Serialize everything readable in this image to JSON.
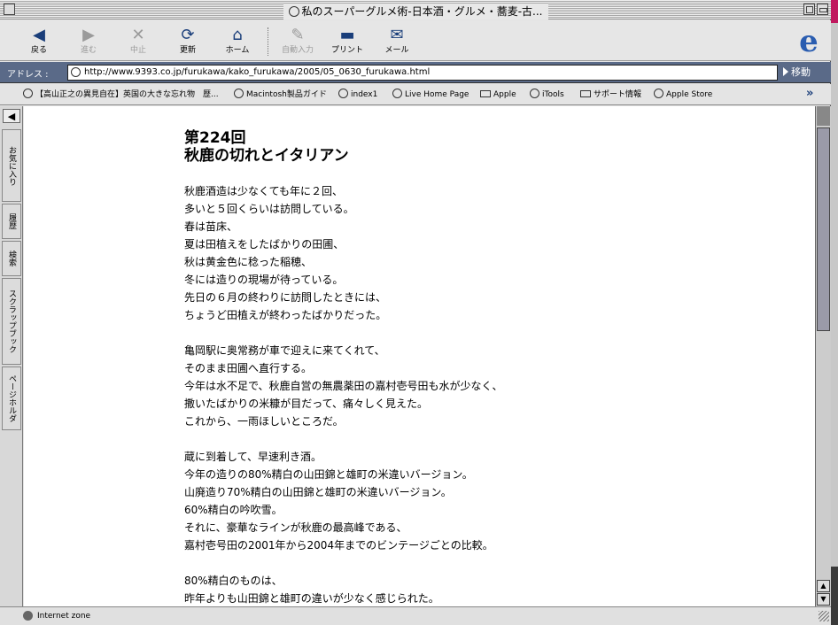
{
  "window": {
    "title": "私のスーパーグルメ術-日本酒・グルメ・蕎麦-古..."
  },
  "toolbar": {
    "buttons": [
      {
        "label": "戻る",
        "icon": "back-arrow-icon",
        "enabled": true
      },
      {
        "label": "進む",
        "icon": "forward-arrow-icon",
        "enabled": false
      },
      {
        "label": "中止",
        "icon": "stop-x-icon",
        "enabled": false
      },
      {
        "label": "更新",
        "icon": "refresh-icon",
        "enabled": true
      },
      {
        "label": "ホーム",
        "icon": "home-icon",
        "enabled": true
      },
      {
        "label": "自動入力",
        "icon": "autofill-icon",
        "enabled": false
      },
      {
        "label": "プリント",
        "icon": "printer-icon",
        "enabled": true
      },
      {
        "label": "メール",
        "icon": "mail-icon",
        "enabled": true
      }
    ]
  },
  "address": {
    "label": "アドレス :",
    "url": "http://www.9393.co.jp/furukawa/kako_furukawa/2005/05_0630_furukawa.html",
    "go_label": "移動"
  },
  "favorites": [
    {
      "label": "【高山正之の異見自在】英国の大きな忘れ物　歴...",
      "icon": "page-globe-icon"
    },
    {
      "label": "Macintosh製品ガイド",
      "icon": "page-globe-icon"
    },
    {
      "label": "index1",
      "icon": "page-globe-icon"
    },
    {
      "label": "Live Home Page",
      "icon": "page-globe-icon"
    },
    {
      "label": "Apple",
      "icon": "folder-icon"
    },
    {
      "label": "iTools",
      "icon": "page-globe-icon"
    },
    {
      "label": "サポート情報",
      "icon": "folder-icon"
    },
    {
      "label": "Apple Store",
      "icon": "page-globe-icon"
    }
  ],
  "explorer_tabs": [
    "お気に入り",
    "履歴",
    "検索",
    "スクラップブック",
    "ページホルダ"
  ],
  "article": {
    "heading_line1": "第224回",
    "heading_line2": "秋鹿の切れとイタリアン",
    "paragraphs": [
      [
        "秋鹿酒造は少なくても年に２回、",
        "多いと５回くらいは訪問している。",
        "春は苗床、",
        "夏は田植えをしたばかりの田圃、",
        "秋は黄金色に稔った稲穂、",
        "冬には造りの現場が待っている。",
        "先日の６月の終わりに訪問したときには、",
        "ちょうど田植えが終わったばかりだった。"
      ],
      [
        "亀岡駅に奥常務が車で迎えに来てくれて、",
        "そのまま田圃へ直行する。",
        "今年は水不足で、秋鹿自営の無農薬田の嘉村壱号田も水が少なく、",
        "撒いたばかりの米糠が目だって、痛々しく見えた。",
        "これから、一雨ほしいところだ。"
      ],
      [
        "蔵に到着して、早速利き酒。",
        "今年の造りの80%精白の山田錦と雄町の米違いバージョン。",
        "山廃造り70%精白の山田錦と雄町の米違いバージョン。",
        "60%精白の吟吹雪。",
        "それに、豪華なラインが秋鹿の最高峰である、",
        "嘉村壱号田の2001年から2004年までのビンテージごとの比較。"
      ],
      [
        "80%精白のものは、",
        "昨年よりも山田錦と雄町の違いが少なく感じられた。"
      ]
    ]
  },
  "status": {
    "zone": "Internet zone"
  }
}
